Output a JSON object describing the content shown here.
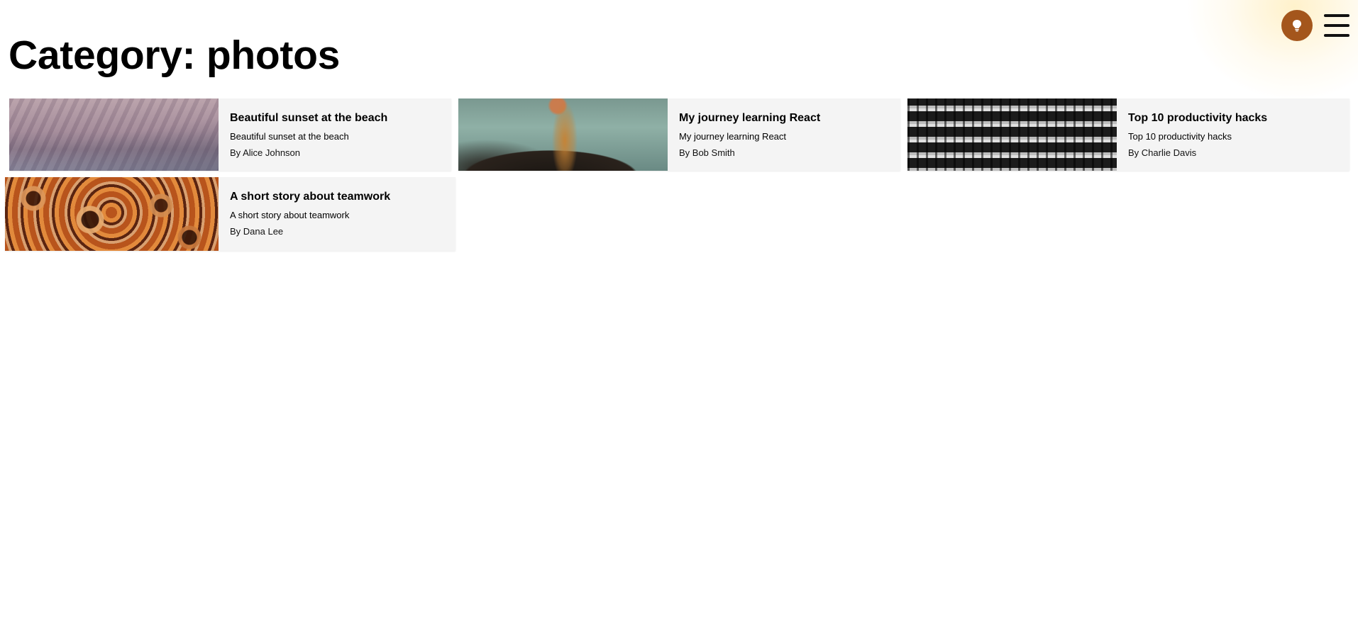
{
  "header": {
    "theme_toggle_icon": "lightbulb-icon",
    "theme_toggle_color": "#a4561c",
    "menu_icon": "hamburger-icon"
  },
  "page": {
    "title": "Category: photos"
  },
  "posts": [
    {
      "title": "Beautiful sunset at the beach",
      "excerpt": "Beautiful sunset at the beach",
      "author": "By Alice Johnson",
      "image": "mountain-photo"
    },
    {
      "title": "My journey learning React",
      "excerpt": "My journey learning React",
      "author": "By Bob Smith",
      "image": "sparkle-photo"
    },
    {
      "title": "Top 10 productivity hacks",
      "excerpt": "Top 10 productivity hacks",
      "author": "By Charlie Davis",
      "image": "building-photo"
    },
    {
      "title": "A short story about teamwork",
      "excerpt": "A short story about teamwork",
      "author": "By Dana Lee",
      "image": "swirl-photo"
    }
  ]
}
